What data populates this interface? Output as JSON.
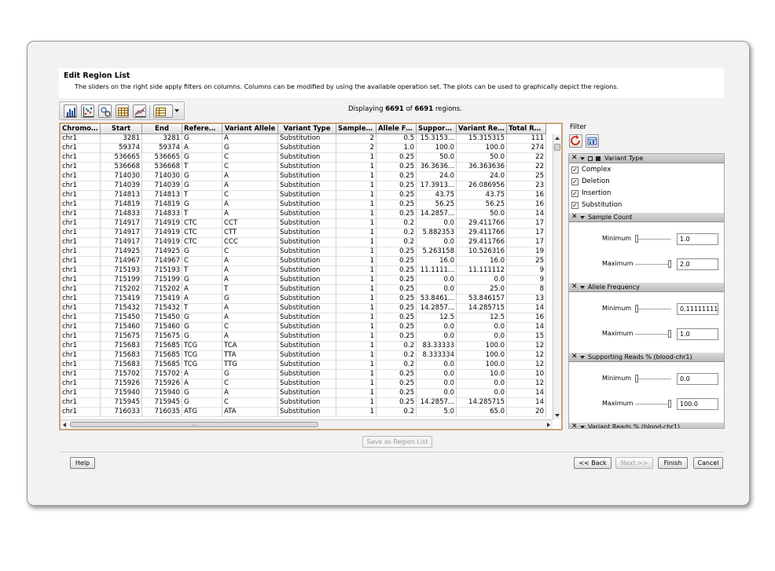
{
  "dialog": {
    "title": "Edit Region List",
    "description": "The sliders on the right side apply filters on columns. Columns can be modified by using the available operation set. The plots can be used to graphically depict the regions."
  },
  "toolbar": {
    "icons": [
      "bar-chart-icon",
      "scatter-plot-icon",
      "column-operation-icon",
      "table-icon",
      "profile-plot-icon",
      "table-dropdown-icon"
    ]
  },
  "display": {
    "prefix": "Displaying",
    "shown": "6691",
    "middle": "of",
    "total": "6691",
    "suffix": "regions."
  },
  "table": {
    "headers": [
      "Chromos...",
      "Start",
      "End",
      "Reference",
      "Variant Allele",
      "Variant Type",
      "Sample ...",
      "Allele Fr...",
      "Supporti...",
      "Variant Rea...",
      "Total Re..."
    ],
    "rows": [
      [
        "chr1",
        "3281",
        "3281",
        "G",
        "A",
        "Substitution",
        "2",
        "0.5",
        "15.3153...",
        "15.315315",
        "111"
      ],
      [
        "chr1",
        "59374",
        "59374",
        "A",
        "G",
        "Substitution",
        "2",
        "1.0",
        "100.0",
        "100.0",
        "274"
      ],
      [
        "chr1",
        "536665",
        "536665",
        "G",
        "C",
        "Substitution",
        "1",
        "0.25",
        "50.0",
        "50.0",
        "22"
      ],
      [
        "chr1",
        "536668",
        "536668",
        "T",
        "C",
        "Substitution",
        "1",
        "0.25",
        "36.3636...",
        "36.363636",
        "22"
      ],
      [
        "chr1",
        "714030",
        "714030",
        "G",
        "A",
        "Substitution",
        "1",
        "0.25",
        "24.0",
        "24.0",
        "25"
      ],
      [
        "chr1",
        "714039",
        "714039",
        "G",
        "A",
        "Substitution",
        "1",
        "0.25",
        "17.3913...",
        "26.086956",
        "23"
      ],
      [
        "chr1",
        "714813",
        "714813",
        "T",
        "C",
        "Substitution",
        "1",
        "0.25",
        "43.75",
        "43.75",
        "16"
      ],
      [
        "chr1",
        "714819",
        "714819",
        "G",
        "A",
        "Substitution",
        "1",
        "0.25",
        "56.25",
        "56.25",
        "16"
      ],
      [
        "chr1",
        "714833",
        "714833",
        "T",
        "A",
        "Substitution",
        "1",
        "0.25",
        "14.2857...",
        "50.0",
        "14"
      ],
      [
        "chr1",
        "714917",
        "714919",
        "CTC",
        "CCT",
        "Substitution",
        "1",
        "0.2",
        "0.0",
        "29.411766",
        "17"
      ],
      [
        "chr1",
        "714917",
        "714919",
        "CTC",
        "CTT",
        "Substitution",
        "1",
        "0.2",
        "5.882353",
        "29.411766",
        "17"
      ],
      [
        "chr1",
        "714917",
        "714919",
        "CTC",
        "CCC",
        "Substitution",
        "1",
        "0.2",
        "0.0",
        "29.411766",
        "17"
      ],
      [
        "chr1",
        "714925",
        "714925",
        "G",
        "C",
        "Substitution",
        "1",
        "0.25",
        "5.263158",
        "10.526316",
        "19"
      ],
      [
        "chr1",
        "714967",
        "714967",
        "C",
        "A",
        "Substitution",
        "1",
        "0.25",
        "16.0",
        "16.0",
        "25"
      ],
      [
        "chr1",
        "715193",
        "715193",
        "T",
        "A",
        "Substitution",
        "1",
        "0.25",
        "11.1111...",
        "11.111112",
        "9"
      ],
      [
        "chr1",
        "715199",
        "715199",
        "G",
        "A",
        "Substitution",
        "1",
        "0.25",
        "0.0",
        "0.0",
        "9"
      ],
      [
        "chr1",
        "715202",
        "715202",
        "A",
        "T",
        "Substitution",
        "1",
        "0.25",
        "0.0",
        "25.0",
        "8"
      ],
      [
        "chr1",
        "715419",
        "715419",
        "A",
        "G",
        "Substitution",
        "1",
        "0.25",
        "53.8461...",
        "53.846157",
        "13"
      ],
      [
        "chr1",
        "715432",
        "715432",
        "T",
        "A",
        "Substitution",
        "1",
        "0.25",
        "14.2857...",
        "14.285715",
        "14"
      ],
      [
        "chr1",
        "715450",
        "715450",
        "G",
        "A",
        "Substitution",
        "1",
        "0.25",
        "12.5",
        "12.5",
        "16"
      ],
      [
        "chr1",
        "715460",
        "715460",
        "G",
        "C",
        "Substitution",
        "1",
        "0.25",
        "0.0",
        "0.0",
        "14"
      ],
      [
        "chr1",
        "715675",
        "715675",
        "G",
        "A",
        "Substitution",
        "1",
        "0.25",
        "0.0",
        "0.0",
        "15"
      ],
      [
        "chr1",
        "715683",
        "715685",
        "TCG",
        "TCA",
        "Substitution",
        "1",
        "0.2",
        "83.33333",
        "100.0",
        "12"
      ],
      [
        "chr1",
        "715683",
        "715685",
        "TCG",
        "TTA",
        "Substitution",
        "1",
        "0.2",
        "8.333334",
        "100.0",
        "12"
      ],
      [
        "chr1",
        "715683",
        "715685",
        "TCG",
        "TTG",
        "Substitution",
        "1",
        "0.2",
        "0.0",
        "100.0",
        "12"
      ],
      [
        "chr1",
        "715702",
        "715702",
        "A",
        "G",
        "Substitution",
        "1",
        "0.25",
        "0.0",
        "10.0",
        "10"
      ],
      [
        "chr1",
        "715926",
        "715926",
        "A",
        "C",
        "Substitution",
        "1",
        "0.25",
        "0.0",
        "0.0",
        "12"
      ],
      [
        "chr1",
        "715940",
        "715940",
        "G",
        "A",
        "Substitution",
        "1",
        "0.25",
        "0.0",
        "0.0",
        "14"
      ],
      [
        "chr1",
        "715945",
        "715945",
        "G",
        "C",
        "Substitution",
        "1",
        "0.25",
        "14.2857...",
        "14.285715",
        "14"
      ],
      [
        "chr1",
        "716033",
        "716035",
        "ATG",
        "ATA",
        "Substitution",
        "1",
        "0.2",
        "5.0",
        "65.0",
        "20"
      ]
    ]
  },
  "filter": {
    "label": "Filter",
    "variant_type": {
      "title": "Variant Type",
      "options": [
        {
          "label": "Complex",
          "checked": true
        },
        {
          "label": "Deletion",
          "checked": true
        },
        {
          "label": "Insertion",
          "checked": true
        },
        {
          "label": "Substitution",
          "checked": true
        }
      ]
    },
    "sample_count": {
      "title": "Sample Count",
      "min_label": "Minimum",
      "min_value": "1.0",
      "max_label": "Maximum",
      "max_value": "2.0"
    },
    "allele_frequency": {
      "title": "Allele Frequency",
      "min_label": "Minimum",
      "min_value": "0.11111111",
      "max_label": "Maximum",
      "max_value": "1.0"
    },
    "supporting_reads": {
      "title": "Supporting Reads % (blood-chr1)",
      "min_label": "Minimum",
      "min_value": "0.0",
      "max_label": "Maximum",
      "max_value": "100.0"
    },
    "variant_reads": {
      "title": "Variant Reads % (blood-chr1)"
    }
  },
  "buttons": {
    "save": "Save as Region List",
    "help": "Help",
    "back": "<< Back",
    "next": "Next >>",
    "finish": "Finish",
    "cancel": "Cancel"
  }
}
